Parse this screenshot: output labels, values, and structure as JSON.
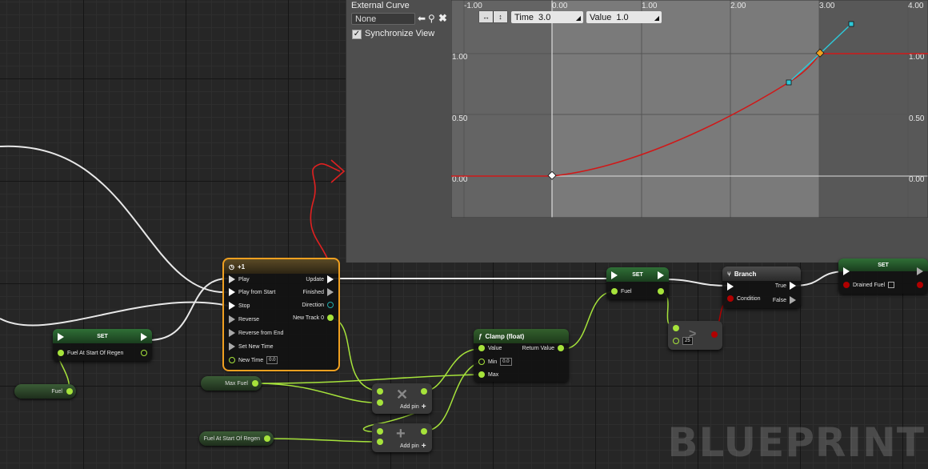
{
  "curve_panel": {
    "external_curve_label": "External Curve",
    "curve_asset_value": "None",
    "sync_label": "Synchronize View",
    "sync_checked": true,
    "time_label": "Time",
    "time_value": "3.0",
    "value_label": "Value",
    "value_value": "1.0",
    "x_ticks": [
      "-1.00",
      "0.00",
      "1.00",
      "2.00",
      "3.00",
      "4.00"
    ],
    "y_ticks_left": [
      "1.00",
      "0.50",
      "0.00"
    ],
    "y_ticks_right": [
      "1.00",
      "0.50",
      "0.00"
    ]
  },
  "nodes": {
    "set_fuel_regen": {
      "title": "SET",
      "pin": "Fuel At Start Of Regen"
    },
    "timeline": {
      "title": "+1",
      "inputs": [
        "Play",
        "Play from Start",
        "Stop",
        "Reverse",
        "Reverse from End",
        "Set New Time",
        "New Time"
      ],
      "new_time_value": "0.0",
      "outputs": [
        "Update",
        "Finished",
        "Direction",
        "New Track 0"
      ]
    },
    "set_fuel": {
      "title": "SET",
      "pin": "Fuel"
    },
    "branch": {
      "title": "Branch",
      "condition": "Condition",
      "true_label": "True",
      "false_label": "False"
    },
    "set_drained": {
      "title": "SET",
      "pin": "Drained Fuel"
    },
    "clamp": {
      "title": "Clamp (float)",
      "value": "Value",
      "return": "Return Value",
      "min": "Min",
      "min_value": "0.0",
      "max": "Max"
    },
    "multiply": {
      "add_pin": "Add pin"
    },
    "add": {
      "add_pin": "Add pin"
    },
    "compare": {
      "value": "25"
    }
  },
  "variables": {
    "fuel": "Fuel",
    "max_fuel": "Max Fuel",
    "fuel_regen": "Fuel At Start Of Regen"
  },
  "watermark": "BLUEPRINT"
}
